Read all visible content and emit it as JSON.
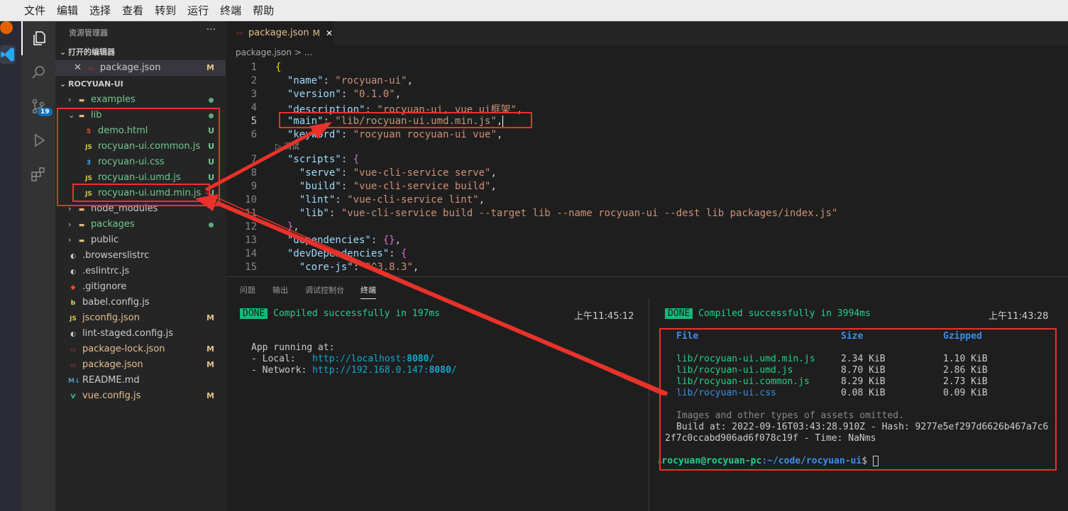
{
  "menu": [
    "文件",
    "编辑",
    "选择",
    "查看",
    "转到",
    "运行",
    "终端",
    "帮助"
  ],
  "sidebar": {
    "title": "资源管理器",
    "dots": "···",
    "open_editors": "打开的编辑器",
    "open_file": "package.json",
    "open_file_status": "M",
    "project": "ROCYUAN-UI",
    "items": [
      {
        "name": "examples",
        "kind": "folder",
        "status": "dot"
      },
      {
        "name": "lib",
        "kind": "folder-open",
        "status": "dot"
      },
      {
        "name": "demo.html",
        "kind": "html",
        "status": "U"
      },
      {
        "name": "rocyuan-ui.common.js",
        "kind": "js",
        "status": "U"
      },
      {
        "name": "rocyuan-ui.css",
        "kind": "css",
        "status": "U"
      },
      {
        "name": "rocyuan-ui.umd.js",
        "kind": "js",
        "status": "U"
      },
      {
        "name": "rocyuan-ui.umd.min.js",
        "kind": "js",
        "status": "U"
      },
      {
        "name": "node_modules",
        "kind": "folder",
        "status": ""
      },
      {
        "name": "packages",
        "kind": "folder",
        "status": "dot"
      },
      {
        "name": "public",
        "kind": "folder",
        "status": ""
      },
      {
        "name": ".browserslistrc",
        "kind": "rc",
        "status": ""
      },
      {
        "name": ".eslintrc.js",
        "kind": "rc",
        "status": ""
      },
      {
        "name": ".gitignore",
        "kind": "git",
        "status": ""
      },
      {
        "name": "babel.config.js",
        "kind": "babel",
        "status": ""
      },
      {
        "name": "jsconfig.json",
        "kind": "js",
        "status": "M"
      },
      {
        "name": "lint-staged.config.js",
        "kind": "rc",
        "status": ""
      },
      {
        "name": "package-lock.json",
        "kind": "npm",
        "status": "M"
      },
      {
        "name": "package.json",
        "kind": "npm",
        "status": "M"
      },
      {
        "name": "README.md",
        "kind": "md",
        "status": ""
      },
      {
        "name": "vue.config.js",
        "kind": "vue",
        "status": "M"
      }
    ]
  },
  "editor": {
    "tab": "package.json",
    "tab_status": "M",
    "breadcrumb": "package.json > ...",
    "codelens": "▷ 调试",
    "lines": [
      "1",
      "2",
      "3",
      "4",
      "5",
      "6",
      "7",
      "8",
      "9",
      "10",
      "11",
      "12",
      "13",
      "14",
      "15"
    ]
  },
  "panel": {
    "tabs": [
      "问题",
      "输出",
      "调试控制台",
      "终端"
    ],
    "left": {
      "done": "DONE",
      "msg": "Compiled successfully in 197ms",
      "time": "上午11:45:12",
      "app": "App running at:",
      "local_label": "- Local:   ",
      "local_url": "http://localhost:",
      "local_port": "8080",
      "net_label": "- Network: ",
      "net_url": "http://192.168.0.147:",
      "net_port": "8080",
      "slash": "/"
    },
    "right": {
      "done": "DONE",
      "msg": "Compiled successfully in 3994ms",
      "time": "上午11:43:28",
      "headers": [
        "File",
        "Size",
        "Gzipped"
      ],
      "rows": [
        [
          "lib/rocyuan-ui.umd.min.js",
          "2.34 KiB",
          "1.10 KiB"
        ],
        [
          "lib/rocyuan-ui.umd.js",
          "8.70 KiB",
          "2.86 KiB"
        ],
        [
          "lib/rocyuan-ui.common.js",
          "8.29 KiB",
          "2.73 KiB"
        ],
        [
          "lib/rocyuan-ui.css",
          "0.08 KiB",
          "0.09 KiB"
        ]
      ],
      "omitted": "Images and other types of assets omitted.",
      "build1": "Build at: 2022-09-16T03:43:28.910Z - Hash: 9277e5ef297d6626b467a7c6",
      "build2": "2f7c0ccabd906ad6f078c19f - Time: NaNms",
      "prompt_user": "rocyuan@rocyuan-pc",
      "prompt_path": ":~/code/rocyuan-ui",
      "prompt_end": "$ "
    }
  }
}
